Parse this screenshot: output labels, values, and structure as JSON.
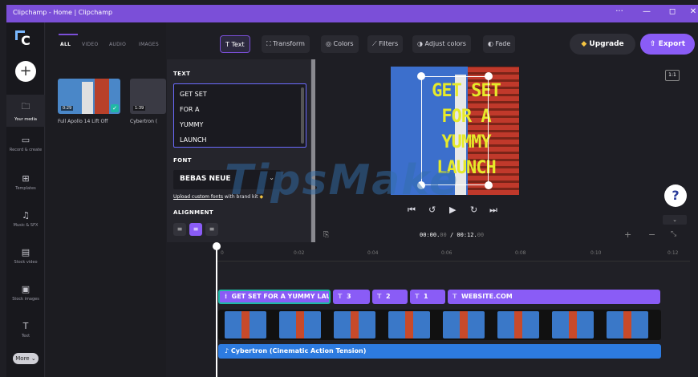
{
  "window": {
    "title": "Clipchamp - Home | Clipchamp",
    "controls": [
      "···",
      "—",
      "◻",
      "✕"
    ]
  },
  "rail": {
    "items": [
      {
        "label": "Your media",
        "icon": "folder-icon"
      },
      {
        "label": "Record & create",
        "icon": "camera-icon"
      },
      {
        "label": "Templates",
        "icon": "templates-icon"
      },
      {
        "label": "Music & SFX",
        "icon": "music-icon"
      },
      {
        "label": "Stock video",
        "icon": "film-icon"
      },
      {
        "label": "Stock images",
        "icon": "image-icon"
      },
      {
        "label": "Text",
        "icon": "text-icon"
      }
    ],
    "more_label": "More ⌄"
  },
  "media": {
    "tabs": [
      "ALL",
      "VIDEO",
      "AUDIO",
      "IMAGES"
    ],
    "items": [
      {
        "name": "Full Apollo 14 Lift Off",
        "duration": "0:29"
      },
      {
        "name": "Cybertron (",
        "duration": "1:39"
      }
    ]
  },
  "toolbar": {
    "tools": [
      "Text",
      "Transform",
      "Colors",
      "Filters",
      "Adjust colors",
      "Fade"
    ],
    "upgrade_label": "Upgrade",
    "export_label": "Export"
  },
  "text_panel": {
    "text_label": "TEXT",
    "lines": [
      "GET SET",
      "FOR A",
      "YUMMY",
      "LAUNCH"
    ],
    "font_label": "FONT",
    "font_value": "BEBAS NEUE",
    "upload_link": "Upload custom fonts",
    "upload_suffix": " with brand kit",
    "alignment_label": "ALIGNMENT"
  },
  "preview": {
    "lines": [
      "GET SET",
      "FOR A",
      "YUMMY",
      "LAUNCH"
    ],
    "aspect_ratio": "1:1",
    "text_color": "#e6ea2a"
  },
  "playback": {
    "current_time": "00:00.",
    "current_frac": "00",
    "separator": " / ",
    "total_time": "00:12.",
    "total_frac": "00"
  },
  "timeline": {
    "ticks": [
      "0",
      "0:02",
      "0:04",
      "0:06",
      "0:08",
      "0:10",
      "0:12"
    ],
    "text_clips": [
      {
        "label": "GET SET FOR A YUMMY LAU"
      },
      {
        "label": "3"
      },
      {
        "label": "2"
      },
      {
        "label": "1"
      },
      {
        "label": "WEBSITE.COM"
      }
    ],
    "audio_clip": "Cybertron (Cinematic Action Tension)"
  },
  "watermark": "TipsMake",
  "colors": {
    "accent": "#8a5cf6",
    "titlebar": "#7b4fd8",
    "audio": "#2d7be0",
    "selection": "#1fb8a5"
  }
}
